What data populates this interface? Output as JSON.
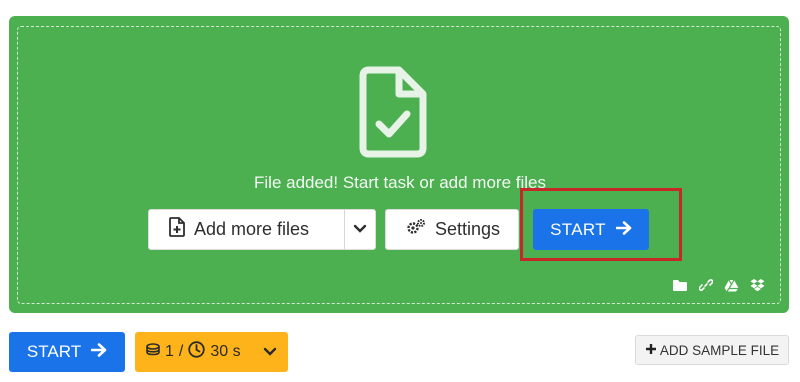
{
  "dropzone": {
    "status_text": "File added! Start task or add more files",
    "icons": [
      "file-check-icon"
    ]
  },
  "toolbar": {
    "add_more_label": "Add more files",
    "settings_label": "Settings",
    "start_label": "START"
  },
  "cloud_sources": [
    "folder-icon",
    "link-icon",
    "google-drive-icon",
    "dropbox-icon"
  ],
  "bottom_bar": {
    "start_label": "START",
    "credits_count": "1",
    "credits_separator": "/",
    "time_label": "30 s",
    "add_sample_label": "ADD SAMPLE FILE"
  },
  "colors": {
    "dropzone_bg": "#4caf50",
    "primary": "#1a73e8",
    "credits_bg": "#ffb31a",
    "highlight": "#c62828"
  }
}
